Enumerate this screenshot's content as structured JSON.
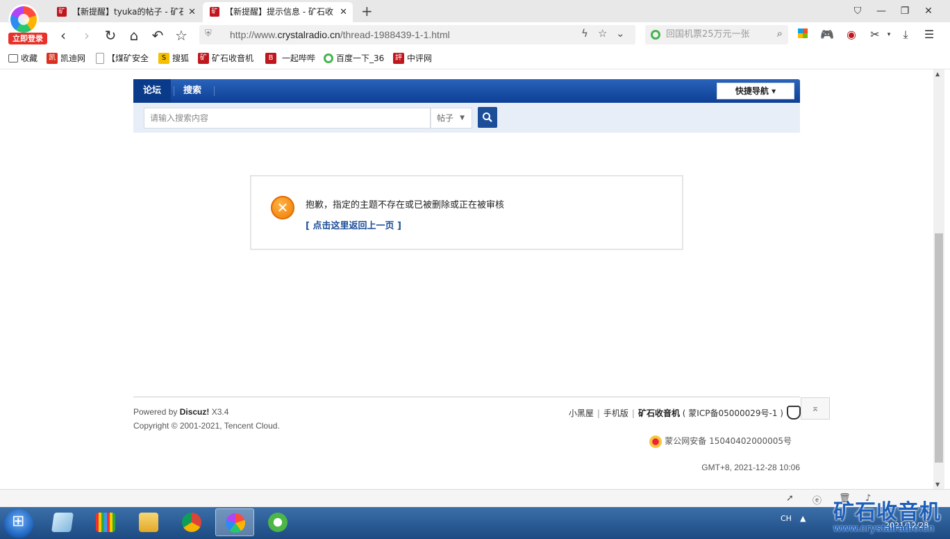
{
  "browser": {
    "login_badge": "立即登录",
    "tabs": [
      {
        "title": "【新提醒】tyuka的帖子 - 矿石",
        "favicon": "矿",
        "close": "✕"
      },
      {
        "title": "【新提醒】提示信息 - 矿石收",
        "favicon": "矿",
        "close": "✕"
      }
    ],
    "new_tab": "+",
    "address": {
      "url_prefix": "http://www.",
      "url_domain": "crystalradio.cn",
      "url_path": "/thread-1988439-1-1.html"
    },
    "search": {
      "placeholder": "回国机票25万元一张"
    },
    "bookmarks": [
      {
        "label": "收藏"
      },
      {
        "label": "凯迪网",
        "icon": "凯"
      },
      {
        "label": "【煤矿安全"
      },
      {
        "label": "搜狐",
        "icon": "S"
      },
      {
        "label": "矿石收音机",
        "icon": "矿"
      },
      {
        "label": "一起哔哔",
        "icon": "B"
      },
      {
        "label": "百度一下_36"
      },
      {
        "label": "中评网",
        "icon": "評"
      }
    ]
  },
  "page": {
    "nav": {
      "forum": "论坛",
      "search": "搜索",
      "quick_nav": "快捷导航 ▾"
    },
    "search_bar": {
      "placeholder": "请输入搜索内容",
      "type": "帖子",
      "caret": "▼"
    },
    "alert": {
      "icon": "✕",
      "message": "抱歉，指定的主题不存在或已被删除或正在被审核",
      "back_link": "[ 点击这里返回上一页 ]"
    },
    "footer": {
      "powered_by": "Powered by ",
      "powered_brand": "Discuz!",
      "version": " X3.4",
      "copyright": "Copyright © 2001-2021, Tencent Cloud.",
      "links": [
        "小黑屋",
        "手机版"
      ],
      "site_name": "矿石收音机",
      "icp": "( 蒙ICP备05000029号-1 )",
      "police": "蒙公网安备 15040402000005号",
      "time": "GMT+8, 2021-12-28 10:06",
      "to_top": "⌅"
    }
  },
  "taskbar": {
    "lang": "CH",
    "clock": "2021/12/28"
  },
  "watermark": {
    "text": "矿石收音机",
    "url": "www.crystalradio.cn"
  },
  "colors": {
    "nav_blue": "#0d3f95",
    "link_blue": "#1c4d99",
    "alert_orange": "#f07b00",
    "brand_red": "#c0161d"
  }
}
